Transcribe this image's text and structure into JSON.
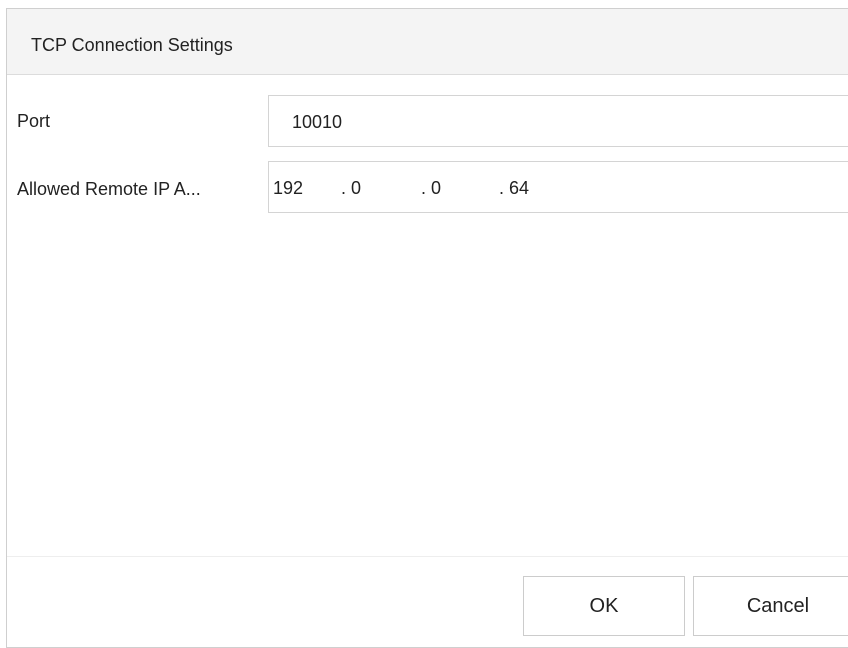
{
  "dialog": {
    "title": "TCP Connection Settings"
  },
  "port": {
    "label": "Port",
    "value": "10010"
  },
  "allowed_ip": {
    "label": "Allowed Remote IP A...",
    "octets": [
      "192",
      "0",
      "0",
      "64"
    ],
    "separator": "."
  },
  "buttons": {
    "ok_label": "OK",
    "cancel_label": "Cancel"
  }
}
